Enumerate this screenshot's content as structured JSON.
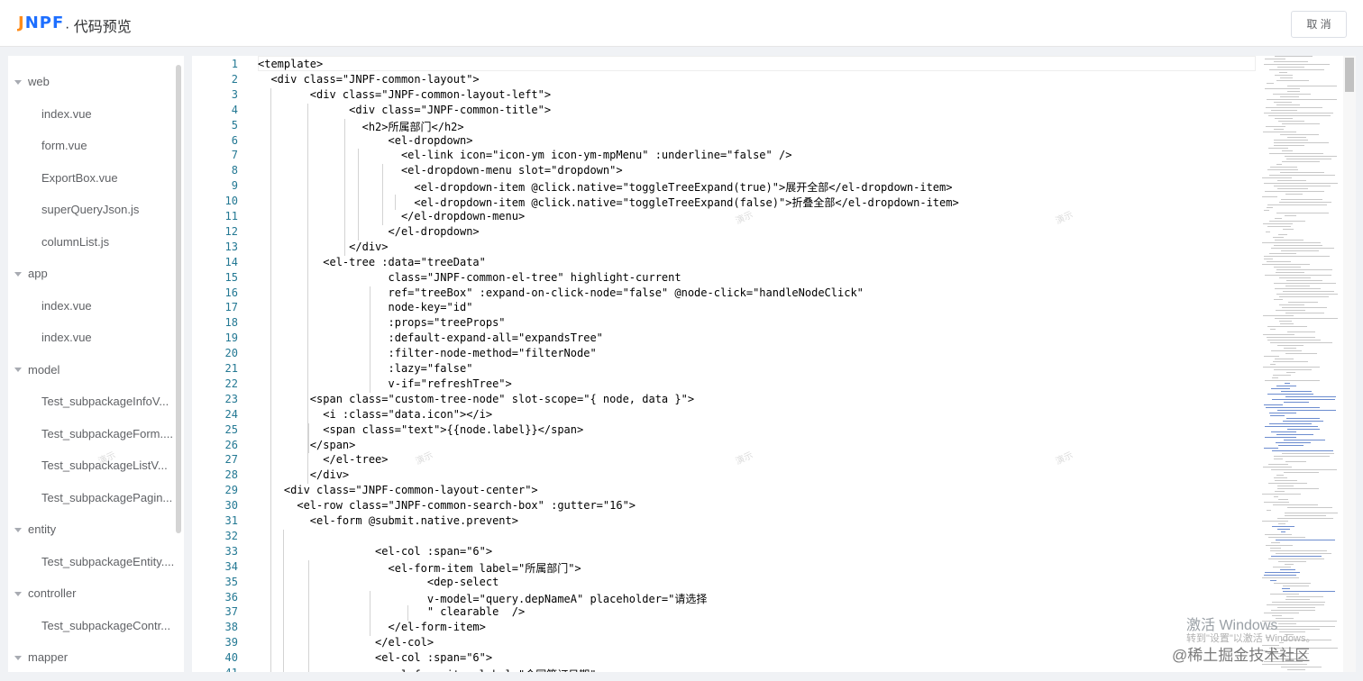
{
  "header": {
    "logo_a": "J",
    "logo_b": "NPF",
    "title": "· 代码预览",
    "cancel_label": "取 消"
  },
  "sidebar": {
    "items": [
      {
        "label": "web",
        "level": 0
      },
      {
        "label": "index.vue",
        "level": 1
      },
      {
        "label": "form.vue",
        "level": 1
      },
      {
        "label": "ExportBox.vue",
        "level": 1
      },
      {
        "label": "superQueryJson.js",
        "level": 1
      },
      {
        "label": "columnList.js",
        "level": 1
      },
      {
        "label": "app",
        "level": 0
      },
      {
        "label": "index.vue",
        "level": 1
      },
      {
        "label": "index.vue",
        "level": 1
      },
      {
        "label": "model",
        "level": 0
      },
      {
        "label": "Test_subpackageInfoV...",
        "level": 1
      },
      {
        "label": "Test_subpackageForm....",
        "level": 1
      },
      {
        "label": "Test_subpackageListV...",
        "level": 1
      },
      {
        "label": "Test_subpackagePagin...",
        "level": 1
      },
      {
        "label": "entity",
        "level": 0
      },
      {
        "label": "Test_subpackageEntity....",
        "level": 1
      },
      {
        "label": "controller",
        "level": 0
      },
      {
        "label": "Test_subpackageContr...",
        "level": 1
      },
      {
        "label": "mapper",
        "level": 0
      }
    ]
  },
  "editor": {
    "lines": [
      {
        "n": "1",
        "text": "<template>"
      },
      {
        "n": "2",
        "text": "  <div class=\"JNPF-common-layout\">"
      },
      {
        "n": "3",
        "text": "        <div class=\"JNPF-common-layout-left\">"
      },
      {
        "n": "4",
        "text": "              <div class=\"JNPF-common-title\">"
      },
      {
        "n": "5",
        "text": "                <h2>所属部门</h2>"
      },
      {
        "n": "6",
        "text": "                    <el-dropdown>"
      },
      {
        "n": "7",
        "text": "                      <el-link icon=\"icon-ym icon-ym-mpMenu\" :underline=\"false\" />"
      },
      {
        "n": "8",
        "text": "                      <el-dropdown-menu slot=\"dropdown\">"
      },
      {
        "n": "9",
        "text": "                        <el-dropdown-item @click.native=\"toggleTreeExpand(true)\">展开全部</el-dropdown-item>"
      },
      {
        "n": "10",
        "text": "                        <el-dropdown-item @click.native=\"toggleTreeExpand(false)\">折叠全部</el-dropdown-item>"
      },
      {
        "n": "11",
        "text": "                      </el-dropdown-menu>"
      },
      {
        "n": "12",
        "text": "                    </el-dropdown>"
      },
      {
        "n": "13",
        "text": "              </div>"
      },
      {
        "n": "14",
        "text": "          <el-tree :data=\"treeData\""
      },
      {
        "n": "15",
        "text": "                    class=\"JNPF-common-el-tree\" highlight-current"
      },
      {
        "n": "16",
        "text": "                    ref=\"treeBox\" :expand-on-click-node=\"false\" @node-click=\"handleNodeClick\""
      },
      {
        "n": "17",
        "text": "                    node-key=\"id\""
      },
      {
        "n": "18",
        "text": "                    :props=\"treeProps\""
      },
      {
        "n": "19",
        "text": "                    :default-expand-all=\"expandsTree\""
      },
      {
        "n": "20",
        "text": "                    :filter-node-method=\"filterNode\""
      },
      {
        "n": "21",
        "text": "                    :lazy=\"false\""
      },
      {
        "n": "22",
        "text": "                    v-if=\"refreshTree\">"
      },
      {
        "n": "23",
        "text": "        <span class=\"custom-tree-node\" slot-scope=\"{ node, data }\">"
      },
      {
        "n": "24",
        "text": "          <i :class=\"data.icon\"></i>"
      },
      {
        "n": "25",
        "text": "          <span class=\"text\">{{node.label}}</span>"
      },
      {
        "n": "26",
        "text": "        </span>"
      },
      {
        "n": "27",
        "text": "          </el-tree>"
      },
      {
        "n": "28",
        "text": "        </div>"
      },
      {
        "n": "29",
        "text": "    <div class=\"JNPF-common-layout-center\">"
      },
      {
        "n": "30",
        "text": "      <el-row class=\"JNPF-common-search-box\" :gutter=\"16\">"
      },
      {
        "n": "31",
        "text": "        <el-form @submit.native.prevent>"
      },
      {
        "n": "32",
        "text": ""
      },
      {
        "n": "33",
        "text": "                  <el-col :span=\"6\">"
      },
      {
        "n": "34",
        "text": "                    <el-form-item label=\"所属部门\">"
      },
      {
        "n": "35",
        "text": "                          <dep-select"
      },
      {
        "n": "36",
        "text": "                          v-model=\"query.depNameA\" placeholder=\"请选择"
      },
      {
        "n": "37",
        "text": "                          \" clearable  />"
      },
      {
        "n": "38",
        "text": "                    </el-form-item>"
      },
      {
        "n": "39",
        "text": "                  </el-col>"
      },
      {
        "n": "40",
        "text": "                  <el-col :span=\"6\">"
      },
      {
        "n": "41",
        "text": "                    <el-form-item label=\"合同签订日期\">"
      }
    ]
  },
  "watermark_text": "演示",
  "activation": {
    "title": "激活 Windows",
    "subtitle": "转到\"设置\"以激活 Windows。"
  },
  "site_watermark": "@稀土掘金技术社区"
}
